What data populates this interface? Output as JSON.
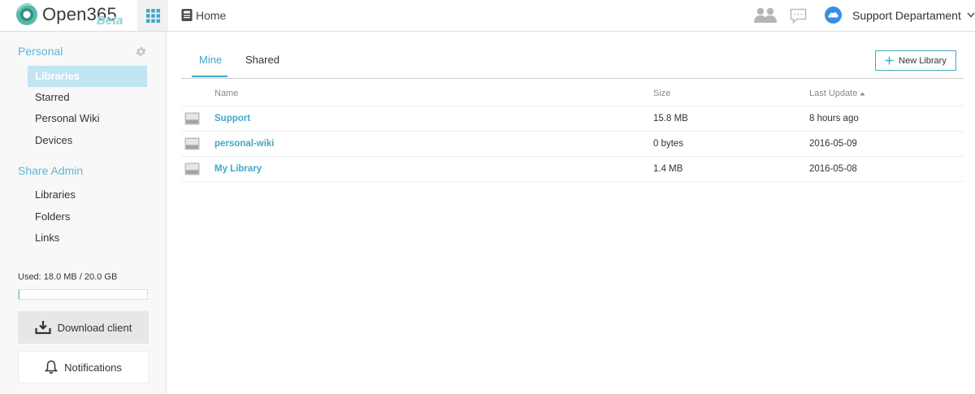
{
  "app": {
    "logo_text": "Open365",
    "logo_badge": "Beta",
    "home_label": "Home",
    "user_name": "Support Departament",
    "icons": {
      "apps": "apps-grid-icon",
      "home": "home-icon",
      "contacts": "contacts-icon",
      "messages": "chat-icon",
      "user": "cloud-avatar-icon",
      "caret": "chevron-down-icon"
    },
    "accent_color": "#40a8cc"
  },
  "sidebar": {
    "personal_heading": "Personal",
    "personal_items": [
      {
        "label": "Libraries",
        "active": true
      },
      {
        "label": "Starred",
        "active": false
      },
      {
        "label": "Personal Wiki",
        "active": false
      },
      {
        "label": "Devices",
        "active": false
      }
    ],
    "share_admin_heading": "Share Admin",
    "share_admin_items": [
      {
        "label": "Libraries"
      },
      {
        "label": "Folders"
      },
      {
        "label": "Links"
      }
    ],
    "usage_text": "Used: 18.0 MB / 20.0 GB",
    "usage_fraction": 0.0009,
    "download_label": "Download client",
    "notifications_label": "Notifications"
  },
  "main": {
    "tabs": [
      {
        "label": "Mine",
        "active": true
      },
      {
        "label": "Shared",
        "active": false
      }
    ],
    "new_library_label": "New Library",
    "columns": {
      "name": "Name",
      "size": "Size",
      "last_update": "Last Update"
    },
    "sort": {
      "column": "last_update",
      "direction": "ascending"
    },
    "rows": [
      {
        "name": "Support",
        "size": "15.8 MB",
        "updated": "8 hours ago"
      },
      {
        "name": "personal-wiki",
        "size": "0 bytes",
        "updated": "2016-05-09"
      },
      {
        "name": "My Library",
        "size": "1.4 MB",
        "updated": "2016-05-08"
      }
    ]
  }
}
